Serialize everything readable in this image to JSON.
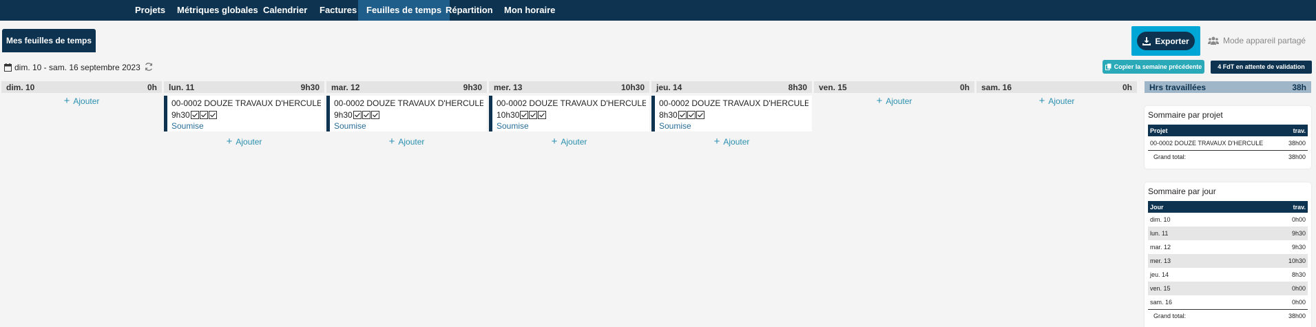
{
  "nav": {
    "items": [
      {
        "label": "Projets"
      },
      {
        "label": "Métriques globales"
      },
      {
        "label": "Calendrier"
      },
      {
        "label": "Factures"
      },
      {
        "label": "Feuilles de temps",
        "active": true
      },
      {
        "label": "Répartition"
      },
      {
        "label": "Mon horaire"
      }
    ]
  },
  "page_tab": "Mes feuilles de temps",
  "export_label": "Exporter",
  "shared_mode_label": "Mode appareil partagé",
  "date_range": "dim. 10 - sam. 16 septembre 2023",
  "copy_week_label": "Copier la semaine précédente",
  "pending_label": "4 FdT en attente de validation",
  "add_label": "Ajouter",
  "days": [
    {
      "name": "dim. 10",
      "total": "0h",
      "entries": []
    },
    {
      "name": "lun. 11",
      "total": "9h30",
      "entries": [
        {
          "project": "00-0002 DOUZE TRAVAUX D'HERCULE",
          "hours": "9h30",
          "status": "Soumise"
        }
      ]
    },
    {
      "name": "mar. 12",
      "total": "9h30",
      "entries": [
        {
          "project": "00-0002 DOUZE TRAVAUX D'HERCULE",
          "hours": "9h30",
          "status": "Soumise"
        }
      ]
    },
    {
      "name": "mer. 13",
      "total": "10h30",
      "entries": [
        {
          "project": "00-0002 DOUZE TRAVAUX D'HERCULE",
          "hours": "10h30",
          "status": "Soumise"
        }
      ]
    },
    {
      "name": "jeu. 14",
      "total": "8h30",
      "entries": [
        {
          "project": "00-0002 DOUZE TRAVAUX D'HERCULE",
          "hours": "8h30",
          "status": "Soumise"
        }
      ]
    },
    {
      "name": "ven. 15",
      "total": "0h",
      "entries": []
    },
    {
      "name": "sam. 16",
      "total": "0h",
      "entries": []
    }
  ],
  "hours_worked": {
    "label": "Hrs travaillées",
    "total": "38h"
  },
  "summary_project": {
    "title": "Sommaire par projet",
    "col1": "Projet",
    "col2": "trav.",
    "rows": [
      {
        "name": "00-0002 DOUZE TRAVAUX D'HERCULE",
        "value": "38h00"
      }
    ],
    "total_label": "Grand total:",
    "total_value": "38h00"
  },
  "summary_day": {
    "title": "Sommaire par jour",
    "col1": "Jour",
    "col2": "trav.",
    "rows": [
      {
        "name": "dim. 10",
        "value": "0h00"
      },
      {
        "name": "lun. 11",
        "value": "9h30"
      },
      {
        "name": "mar. 12",
        "value": "9h30"
      },
      {
        "name": "mer. 13",
        "value": "10h30"
      },
      {
        "name": "jeu. 14",
        "value": "8h30"
      },
      {
        "name": "ven. 15",
        "value": "0h00"
      },
      {
        "name": "sam. 16",
        "value": "0h00"
      }
    ],
    "total_label": "Grand total:",
    "total_value": "38h00"
  },
  "colors": {
    "navy": "#0d3350",
    "active_tab": "#1f5d8a",
    "accent": "#00a7d6",
    "teal": "#2aa9b8",
    "link": "#2a8fb0"
  }
}
